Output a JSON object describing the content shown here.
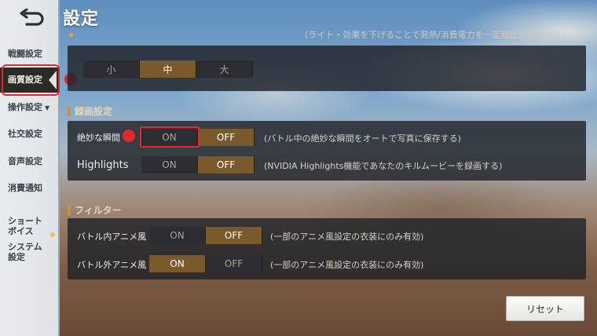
{
  "title": "設定",
  "top_note": "(ライト・効果を下げることで発熱/消費電力を一定程度抑制できる)",
  "sidebar": {
    "items": [
      {
        "label": "戦闘設定"
      },
      {
        "label": "画質設定"
      },
      {
        "label": "操作設定"
      },
      {
        "label": "社交設定"
      },
      {
        "label": "音声設定"
      },
      {
        "label": "消費通知"
      },
      {
        "label": "ショート\nボイス"
      },
      {
        "label": "システム\n設定"
      }
    ],
    "operation_arrow": "▼"
  },
  "quality": {
    "options": [
      "小",
      "中",
      "大"
    ],
    "selected": "中"
  },
  "recording": {
    "header": "録画設定",
    "rows": [
      {
        "label": "絶妙な瞬間",
        "on": "ON",
        "off": "OFF",
        "selected": "OFF",
        "note": "(バトル中の絶妙な瞬間をオートで写真に保存する)"
      },
      {
        "label": "Highlights",
        "on": "ON",
        "off": "OFF",
        "selected": "OFF",
        "note": "(NVIDIA Highlights機能であなたのキルムービーを録画する)"
      }
    ]
  },
  "filter": {
    "header": "フィルター",
    "rows": [
      {
        "label": "バトル内アニメ風",
        "on": "ON",
        "off": "OFF",
        "selected": "OFF",
        "note": "(一部のアニメ風設定の衣装にのみ有効)"
      },
      {
        "label": "バトル外アニメ風",
        "on": "ON",
        "off": "OFF",
        "selected": "ON",
        "note": "(一部のアニメ風設定の衣装にのみ有効)"
      }
    ]
  },
  "reset_label": "リセット",
  "colors": {
    "accent": "#7a5a2c",
    "highlight_red": "#e0282e",
    "sidebar_bg": "#e9ecef"
  },
  "icons": {
    "back": "back-arrow-icon"
  }
}
